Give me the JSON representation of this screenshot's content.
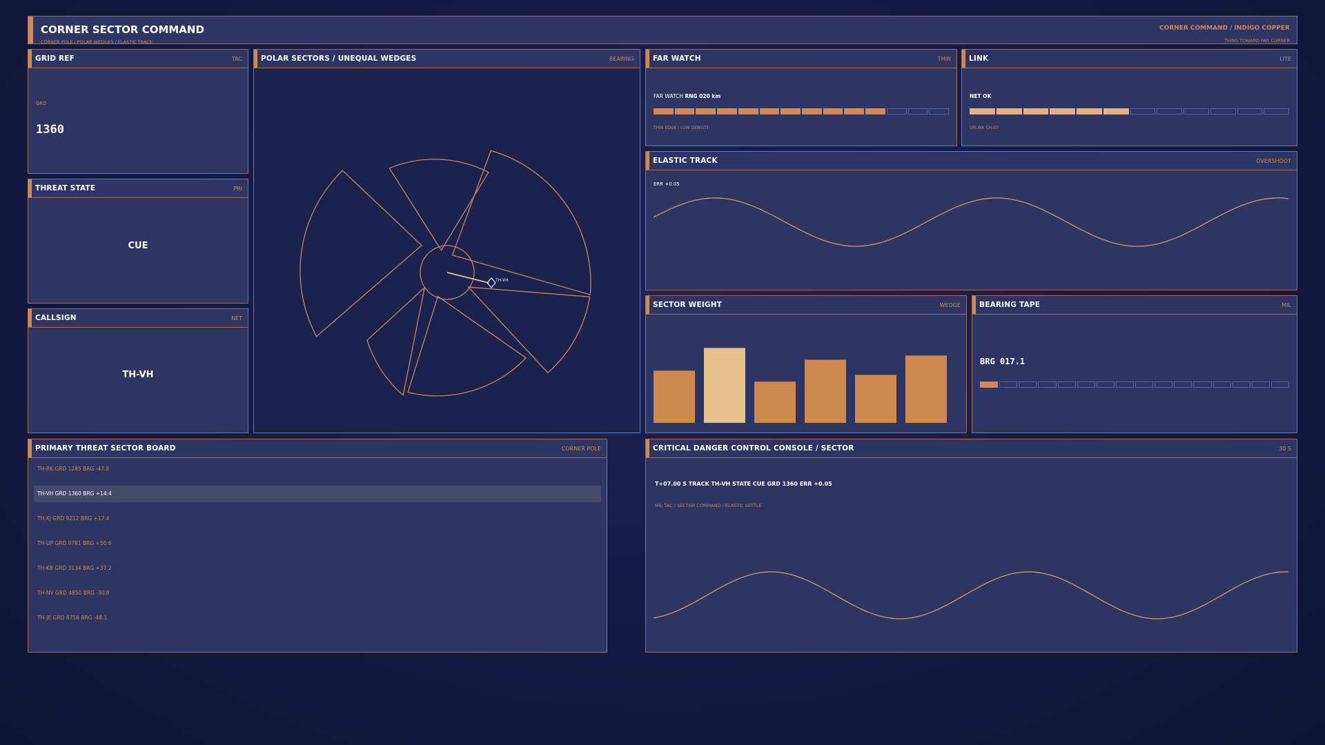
{
  "header": {
    "title": "CORNER SECTOR COMMAND",
    "subtitle": "CORNER POLE / POLAR WEDGES / ELASTIC TRACK",
    "right_title": "CORNER COMMAND / INDIGO COPPER",
    "right_sub": "THINS TOWARD FAR CORNER"
  },
  "grid_ref": {
    "title": "GRID REF",
    "tag": "TAC",
    "label": "GRD",
    "value": "1360"
  },
  "threat_state": {
    "title": "THREAT STATE",
    "tag": "PRI",
    "value": "CUE"
  },
  "callsign": {
    "title": "CALLSIGN",
    "tag": "NET",
    "value": "TH-VH"
  },
  "polar": {
    "title": "POLAR SECTORS / UNEQUAL WEDGES",
    "tag": "BEARING",
    "target_label": "TH-VH"
  },
  "far_watch": {
    "title": "FAR WATCH",
    "tag": "THIN",
    "line_label": "FAR WATCH",
    "line_value": "RNG 020 km",
    "footer": "THIN EDGE / LOW DENSITY",
    "segments_total": 14,
    "segments_on": 11
  },
  "link": {
    "title": "LINK",
    "tag": "LITE",
    "status_label": "NET",
    "status_value": "OK",
    "footer": "UPLINK CH-03",
    "segments_total": 12,
    "segments_on": 6
  },
  "elastic_track": {
    "title": "ELASTIC TRACK",
    "tag": "OVERSHOOT",
    "readout": "ERR +0.05"
  },
  "sector_weight": {
    "title": "SECTOR WEIGHT",
    "tag": "WEDGE",
    "values": [
      0.62,
      0.89,
      0.49,
      0.75,
      0.57,
      0.8
    ],
    "highlight_index": 1
  },
  "bearing_tape": {
    "title": "BEARING TAPE",
    "tag": "MIL",
    "readout": "BRG 017.1",
    "segments_total": 16,
    "segments_on": 1
  },
  "threat_board": {
    "title": "PRIMARY THREAT SECTOR BOARD",
    "tag": "CORNER POLE",
    "rows": [
      "TH-RK GRD 1285 BRG -47.8",
      "TH-VH GRD 1360 BRG +14.4",
      "TH-XJ GRD 9212 BRG +17.4",
      "TH-UP GRD 9781 BRG +50.6",
      "TH-KB GRD 3134 BRG +37.2",
      "TH-NV GRD 4850 BRG -30.8",
      "TH-JE GRD 8756 BRG -48.1"
    ],
    "selected_index": 1
  },
  "console": {
    "title": "CRITICAL DANGER CONTROL CONSOLE / SECTOR",
    "tag": "30 S",
    "status": "T+07.00 S TRACK TH-VH STATE CUE GRD 1360 ERR +0.05",
    "sub": "MIL TAC / SECTOR COMMAND / ELASTIC SETTLE"
  },
  "colors": {
    "accent": "#d08a4f",
    "accent_light": "#e8bf8e",
    "panel": "#2c3563",
    "border": "#a86e4a",
    "background": "#151b45"
  }
}
